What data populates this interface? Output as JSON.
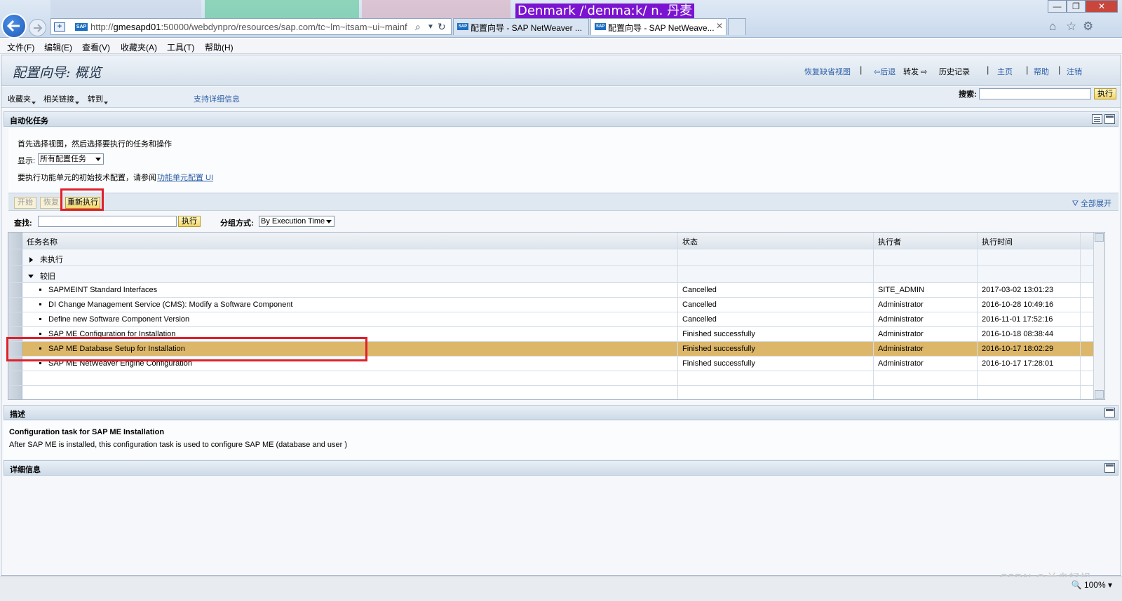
{
  "browser": {
    "address_url_prefix": "http://",
    "address_url_host": "gmesapd01",
    "address_url_rest": ":50000/webdynpro/resources/sap.com/tc~lm~itsam~ui~mainf",
    "tabs": [
      {
        "label": "配置向导 - SAP NetWeaver ..."
      },
      {
        "label": "配置向导 - SAP NetWeave..."
      }
    ],
    "dict_popup": "Denmark /ˈdenmaːk/   n. 丹麦",
    "window_buttons": {
      "min": "—",
      "max": "❐",
      "close": "✕"
    },
    "zoom": "100%"
  },
  "menu": [
    "文件(F)",
    "编辑(E)",
    "查看(V)",
    "收藏夹(A)",
    "工具(T)",
    "帮助(H)"
  ],
  "header": {
    "title": "配置向导: 概览",
    "restore_view": "恢复缺省视图",
    "back": "后退",
    "forward": "转发",
    "history": "历史记录",
    "home": "主页",
    "help": "帮助",
    "logout": "注销"
  },
  "toolbar": {
    "favorites": "收藏夹",
    "related_links": "相关链接",
    "goto": "转到",
    "support_info": "支持详细信息",
    "search_label": "搜索:",
    "search_value": "",
    "execute": "执行"
  },
  "automation": {
    "section_title": "自动化任务",
    "intro": "首先选择视图，然后选择要执行的任务和操作",
    "show_label": "显示:",
    "show_value": "所有配置任务",
    "note_text": "要执行功能单元的初始技术配置，请参阅",
    "note_link": "功能单元配置 UI",
    "buttons": {
      "start": "开始",
      "resume": "恢复",
      "rerun": "重新执行"
    },
    "expand_all": "全部展开",
    "find_label": "查找:",
    "find_value": "",
    "find_execute": "执行",
    "group_label": "分组方式:",
    "group_value": "By Execution Time"
  },
  "table": {
    "columns": [
      "任务名称",
      "状态",
      "执行者",
      "执行时间"
    ],
    "groups": [
      {
        "label": "未执行",
        "expanded": false
      },
      {
        "label": "较旧",
        "expanded": true
      }
    ],
    "rows": [
      {
        "task": "SAPMEINT Standard Interfaces",
        "status": "Cancelled",
        "executor": "SITE_ADMIN",
        "time": "2017-03-02 13:01:23"
      },
      {
        "task": "DI Change Management Service (CMS): Modify a Software Component",
        "status": "Cancelled",
        "executor": "Administrator",
        "time": "2016-10-28 10:49:16"
      },
      {
        "task": "Define new Software Component Version",
        "status": "Cancelled",
        "executor": "Administrator",
        "time": "2016-11-01 17:52:16"
      },
      {
        "task": "SAP ME Configuration for Installation",
        "status": "Finished successfully",
        "executor": "Administrator",
        "time": "2016-10-18 08:38:44"
      },
      {
        "task": "SAP ME Database Setup for Installation",
        "status": "Finished successfully",
        "executor": "Administrator",
        "time": "2016-10-17 18:02:29",
        "selected": true
      },
      {
        "task": "SAP ME NetWeaver Engine Configuration",
        "status": "Finished successfully",
        "executor": "Administrator",
        "time": "2016-10-17 17:28:01"
      }
    ]
  },
  "description": {
    "section_title": "描述",
    "heading": "Configuration task for SAP ME Installation",
    "text": "After SAP ME is installed, this configuration task  is used to configure SAP ME (database and user )"
  },
  "details": {
    "section_title": "详细信息"
  },
  "watermark": "CSDN @兰舟轻帆",
  "colors": {
    "highlight_row": "#ddb769",
    "annotation_red": "#e0202a",
    "link": "#2c5fa8"
  }
}
